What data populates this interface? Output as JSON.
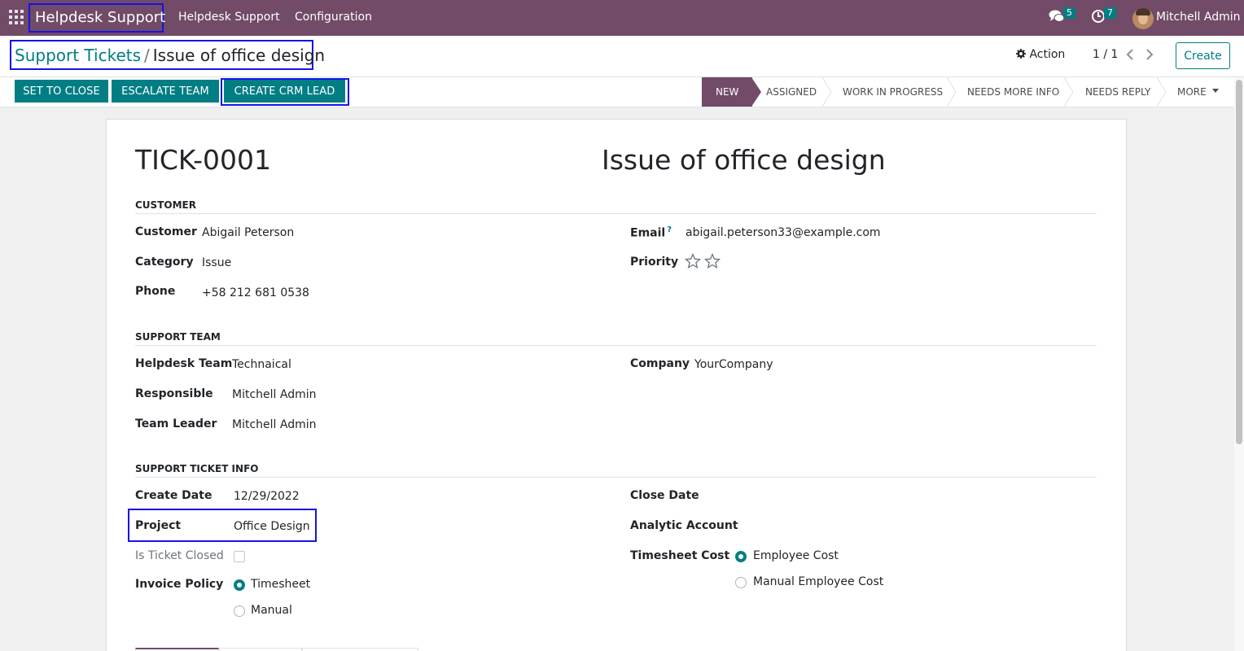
{
  "navbar": {
    "brand": "Helpdesk Support",
    "menu": [
      "Helpdesk Support",
      "Configuration"
    ],
    "messages_count": "5",
    "activities_count": "7",
    "user_name": "Mitchell Admin",
    "icons": [
      "apps-grid-icon",
      "chat-icon",
      "clock-icon"
    ]
  },
  "control_panel": {
    "breadcrumb_parent": "Support Tickets",
    "breadcrumb_separator": "/",
    "breadcrumb_current": "Issue of office design",
    "action_label": "Action",
    "pager": "1 / 1",
    "create_label": "Create"
  },
  "statusbar": {
    "buttons": [
      "SET TO CLOSE",
      "ESCALATE TEAM",
      "CREATE CRM LEAD"
    ],
    "stages": [
      "NEW",
      "ASSIGNED",
      "WORK IN PROGRESS",
      "NEEDS MORE INFO",
      "NEEDS REPLY",
      "MORE"
    ],
    "active_stage": "NEW"
  },
  "ticket": {
    "number": "TICK-0001",
    "name": "Issue  of office design"
  },
  "sections": {
    "customer": {
      "title": "CUSTOMER",
      "customer_label": "Customer",
      "customer": "Abigail Peterson",
      "category_label": "Category",
      "category": "Issue",
      "phone_label": "Phone",
      "phone": "+58 212 681 0538",
      "email_label": "Email",
      "email_help": "?",
      "email": "abigail.peterson33@example.com",
      "priority_label": "Priority",
      "priority_stars": 0,
      "priority_max": 2
    },
    "support_team": {
      "title": "SUPPORT TEAM",
      "team_label": "Helpdesk Team",
      "team": "Technaical",
      "responsible_label": "Responsible",
      "responsible": "Mitchell Admin",
      "leader_label": "Team Leader",
      "leader": "Mitchell Admin",
      "company_label": "Company",
      "company": "YourCompany"
    },
    "ticket_info": {
      "title": "SUPPORT TICKET INFO",
      "create_date_label": "Create Date",
      "create_date": "12/29/2022",
      "project_label": "Project",
      "project": "Office Design",
      "closed_label": "Is Ticket Closed",
      "closed": false,
      "invoice_label": "Invoice Policy",
      "invoice_options": [
        "Timesheet",
        "Manual"
      ],
      "invoice_selected": "Timesheet",
      "close_date_label": "Close Date",
      "analytic_label": "Analytic Account",
      "timesheet_cost_label": "Timesheet Cost",
      "cost_options": [
        "Employee Cost",
        "Manual Employee Cost"
      ],
      "cost_selected": "Employee Cost"
    }
  },
  "colors": {
    "brand": "#714b67",
    "accent": "#017e84",
    "highlight_box": "#1414e6"
  }
}
